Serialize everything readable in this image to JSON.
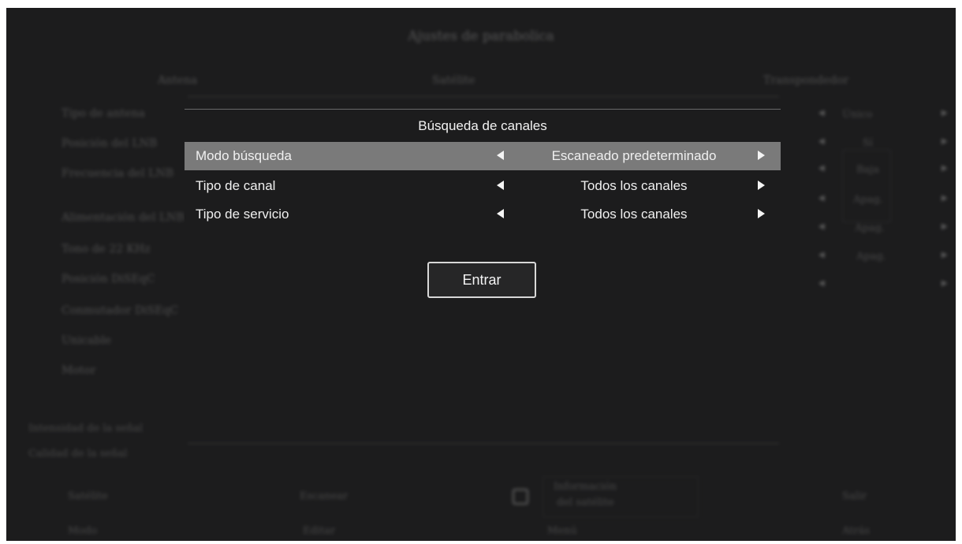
{
  "background": {
    "title": "Ajustes de parabolica",
    "head_left": "Antena",
    "head_center": "Satélite",
    "head_right": "Transpondedor",
    "left_items": [
      "Tipo de antena",
      "Posición del LNB",
      "Frecuencia del LNB",
      "Alimentación del LNB",
      "Tono de 22 KHz",
      "Posición DiSEqC",
      "Conmutador DiSEqC",
      "Unicable",
      "Motor"
    ],
    "right_values": [
      "Único",
      "Sí",
      "Baja",
      "Apag.",
      "Apag.",
      "Apag.",
      ""
    ],
    "bottom_left_1": "Intensidad de la señal",
    "bottom_left_2": "Calidad de la señal",
    "footer_left": "Satélite",
    "footer_left2": "Modo",
    "footer_mid": "Escanear",
    "footer_mid2": "Editar",
    "footer_panel_1": "Información",
    "footer_panel_2": "del satélite",
    "footer_right": "Salir",
    "footer_bottom_center": "Menú",
    "footer_bottom_right": "Atrás"
  },
  "dialog": {
    "title": "Búsqueda de canales",
    "rows": [
      {
        "label": "Modo búsqueda",
        "value": "Escaneado predeterminado"
      },
      {
        "label": "Tipo de canal",
        "value": "Todos los canales"
      },
      {
        "label": "Tipo de servicio",
        "value": "Todos los canales"
      }
    ],
    "enter_label": "Entrar"
  }
}
